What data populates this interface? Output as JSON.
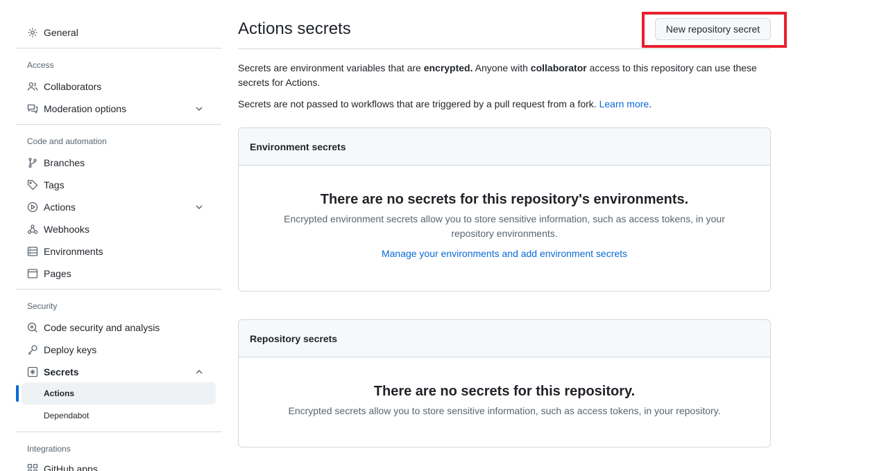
{
  "sidebar": {
    "general": "General",
    "access_title": "Access",
    "collaborators": "Collaborators",
    "moderation": "Moderation options",
    "code_title": "Code and automation",
    "branches": "Branches",
    "tags": "Tags",
    "actions": "Actions",
    "webhooks": "Webhooks",
    "environments": "Environments",
    "pages": "Pages",
    "security_title": "Security",
    "code_security": "Code security and analysis",
    "deploy_keys": "Deploy keys",
    "secrets": "Secrets",
    "secrets_actions": "Actions",
    "secrets_dependabot": "Dependabot",
    "integrations_title": "Integrations",
    "github_apps": "GitHub apps"
  },
  "main": {
    "title": "Actions secrets",
    "new_button": "New repository secret",
    "intro_a": "Secrets are environment variables that are ",
    "intro_b": "encrypted.",
    "intro_c": " Anyone with ",
    "intro_d": "collaborator",
    "intro_e": " access to this repository can use these secrets for Actions.",
    "intro2_a": "Secrets are not passed to workflows that are triggered by a pull request from a fork. ",
    "learn_more": "Learn more",
    "intro2_b": ".",
    "env_box": {
      "header": "Environment secrets",
      "title": "There are no secrets for this repository's environments.",
      "desc": "Encrypted environment secrets allow you to store sensitive information, such as access tokens, in your repository environments.",
      "link": "Manage your environments and add environment secrets"
    },
    "repo_box": {
      "header": "Repository secrets",
      "title": "There are no secrets for this repository.",
      "desc": "Encrypted secrets allow you to store sensitive information, such as access tokens, in your repository."
    }
  },
  "colors": {
    "accent": "#0969da",
    "highlight": "#e8202e",
    "border": "#d1d9e0",
    "muted": "#59636e"
  },
  "icons": [
    "gear-icon",
    "people-icon",
    "comment-discussion-icon",
    "git-branch-icon",
    "tag-icon",
    "play-icon",
    "webhook-icon",
    "server-icon",
    "browser-icon",
    "codescan-icon",
    "key-icon",
    "key-asterisk-icon",
    "chevron-down-icon",
    "chevron-up-icon",
    "apps-icon"
  ]
}
